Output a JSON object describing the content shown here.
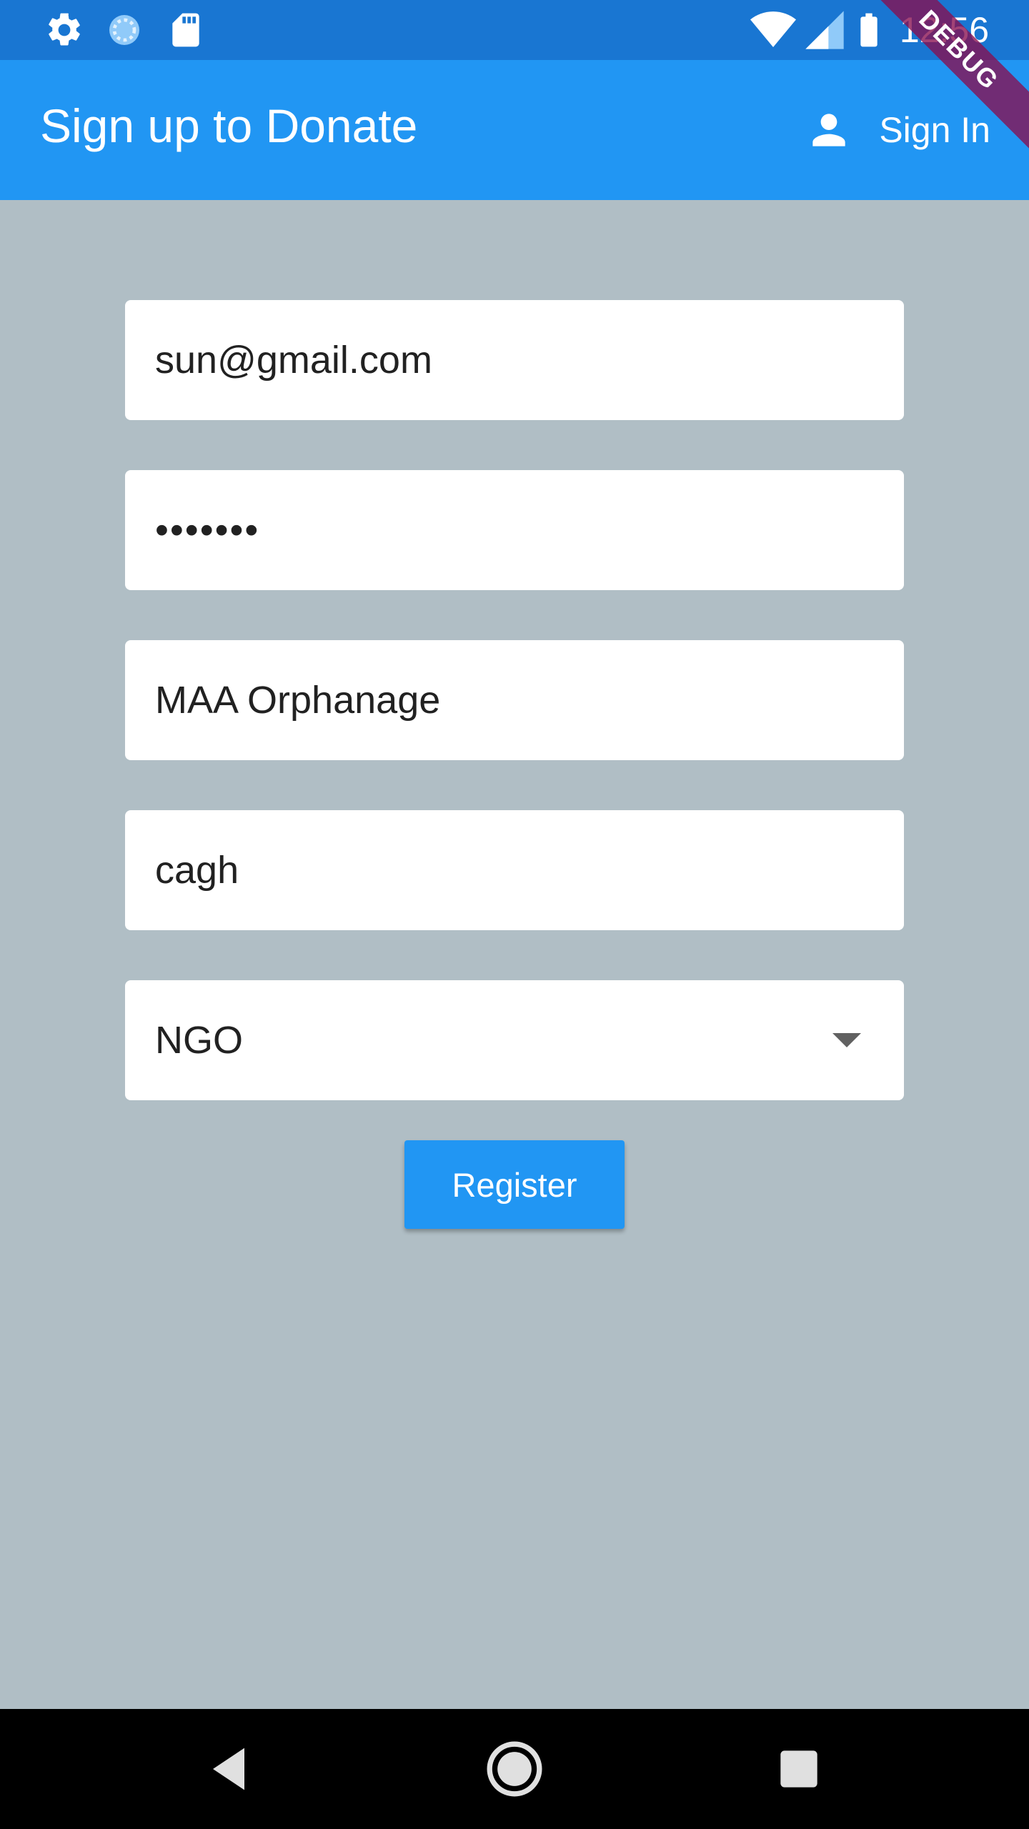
{
  "status_bar": {
    "time": "12:56",
    "icons": [
      "settings-icon",
      "sync-icon",
      "sd-card-icon",
      "wifi-icon",
      "signal-icon",
      "battery-icon"
    ],
    "background": "#1976d2"
  },
  "app_bar": {
    "title": "Sign up to Donate",
    "action_label": "Sign In",
    "action_icon": "person-icon",
    "background": "#2196f3"
  },
  "debug_banner": "DEBUG",
  "form": {
    "email": "sun@gmail.com",
    "password": "•••••••",
    "organization": "MAA Orphanage",
    "address": "cagh",
    "type_selected": "NGO",
    "register_label": "Register"
  },
  "nav_bar": {
    "icons": [
      "back-icon",
      "home-icon",
      "recents-icon"
    ]
  },
  "colors": {
    "page_background": "#b0bec5",
    "accent": "#2196f3"
  }
}
